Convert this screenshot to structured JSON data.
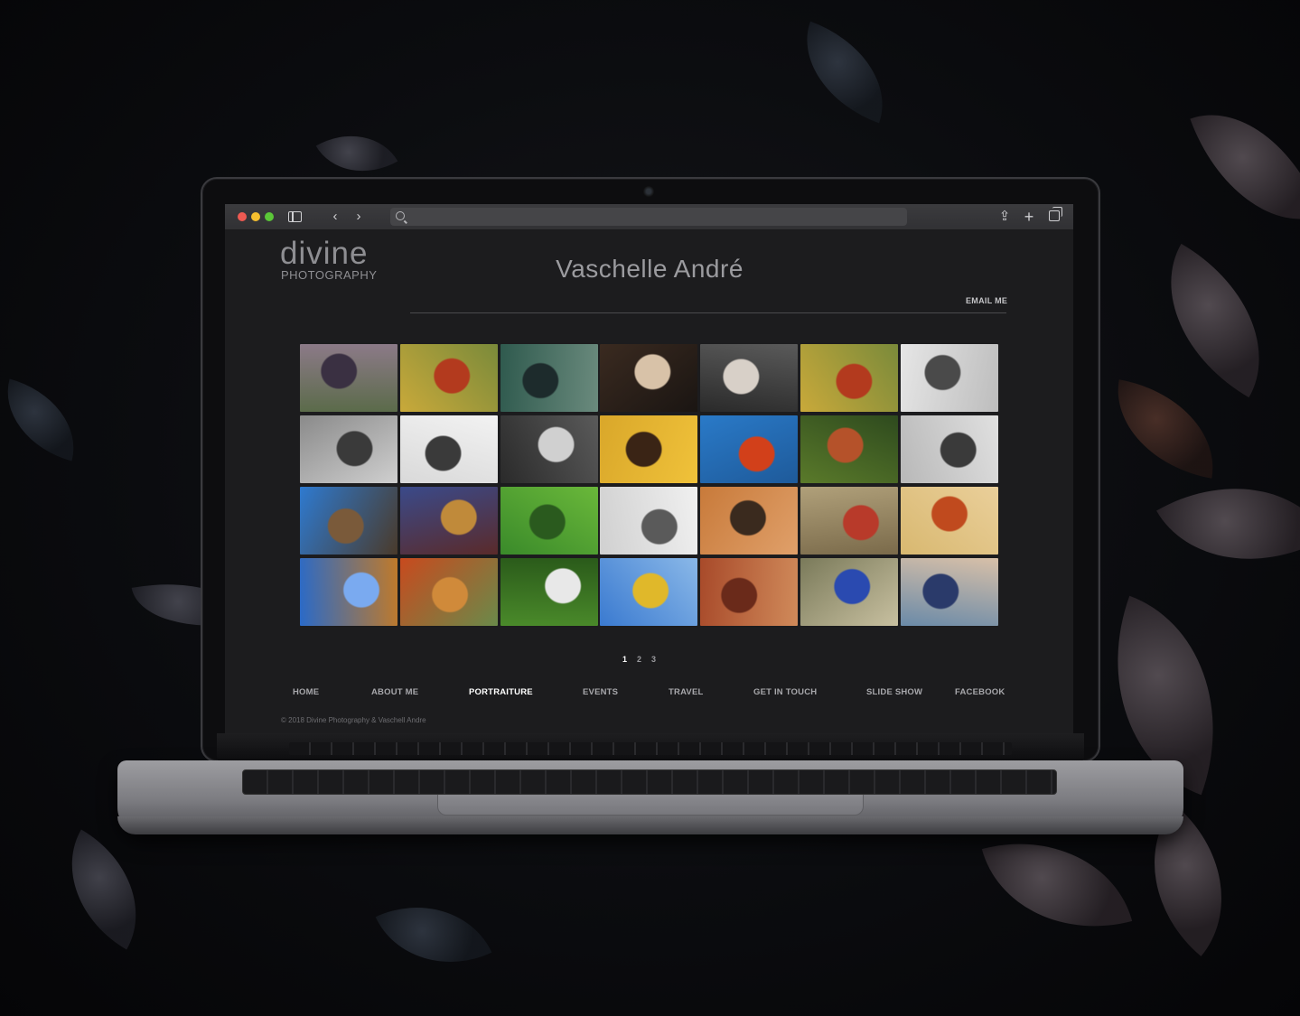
{
  "browser": {
    "address_placeholder": "",
    "icons": [
      "sidebar-icon",
      "back-icon",
      "forward-icon",
      "search-icon",
      "share-icon",
      "plus-icon",
      "tabs-icon"
    ],
    "back_glyph": "‹",
    "forward_glyph": "›",
    "share_glyph": "⇪",
    "plus_glyph": "+"
  },
  "site": {
    "logo_top": "divine",
    "logo_bottom": "PHOTOGRAPHY",
    "title": "Vaschelle André",
    "email_link": "EMAIL ME"
  },
  "gallery": {
    "thumbnails": [
      {
        "colors": [
          "#5b6b4a",
          "#3a3042",
          "#8c7a88"
        ]
      },
      {
        "colors": [
          "#c9a93a",
          "#b33a1e",
          "#7a8a3a"
        ]
      },
      {
        "colors": [
          "#2f5a4e",
          "#1d2b2c",
          "#6a8a7d"
        ]
      },
      {
        "colors": [
          "#3a2a20",
          "#d8c2a8",
          "#1a1512"
        ]
      },
      {
        "colors": [
          "#2a2a2a",
          "#d8d0c8",
          "#5a5a5a"
        ]
      },
      {
        "colors": [
          "#c9a93a",
          "#b33a1e",
          "#7a8a3a"
        ]
      },
      {
        "colors": [
          "#e6e6e6",
          "#4a4a4a",
          "#bdbdbd"
        ]
      },
      {
        "colors": [
          "#8a8a8a",
          "#3a3a3a",
          "#cfcfcf"
        ]
      },
      {
        "colors": [
          "#d9d9d9",
          "#3a3a3a",
          "#f2f2f2"
        ]
      },
      {
        "colors": [
          "#2a2a2a",
          "#d0d0d0",
          "#5a5a5a"
        ]
      },
      {
        "colors": [
          "#d9a72a",
          "#3a2415",
          "#f0c23a"
        ]
      },
      {
        "colors": [
          "#2a7ac8",
          "#d2401a",
          "#1e5a9a"
        ]
      },
      {
        "colors": [
          "#5a7a2a",
          "#b5522a",
          "#2e4a1e"
        ]
      },
      {
        "colors": [
          "#b8b8b8",
          "#3a3a3a",
          "#e0e0e0"
        ]
      },
      {
        "colors": [
          "#2e7ad0",
          "#7a5a3a",
          "#4a3a2a"
        ]
      },
      {
        "colors": [
          "#3a4a8a",
          "#c08a3a",
          "#5a2a2a"
        ]
      },
      {
        "colors": [
          "#3a8a2a",
          "#2a5a1e",
          "#6ab83a"
        ]
      },
      {
        "colors": [
          "#d0d0d0",
          "#5a5a5a",
          "#f0f0f0"
        ]
      },
      {
        "colors": [
          "#c87a3a",
          "#3a2a1e",
          "#e0a06a"
        ]
      },
      {
        "colors": [
          "#b0a07a",
          "#b83a2a",
          "#7a6a4a"
        ]
      },
      {
        "colors": [
          "#d8b870",
          "#c04a1e",
          "#eacf9a"
        ]
      },
      {
        "colors": [
          "#2a6ac8",
          "#7aaaf0",
          "#c07a2a"
        ]
      },
      {
        "colors": [
          "#c84a1e",
          "#d08a3a",
          "#6a8a4a"
        ]
      },
      {
        "colors": [
          "#4a8a2a",
          "#e8e8e8",
          "#2a5a1a"
        ]
      },
      {
        "colors": [
          "#3a7ad0",
          "#e0b82a",
          "#8ab8e8"
        ]
      },
      {
        "colors": [
          "#a84a2a",
          "#6a2a1a",
          "#d08a5a"
        ]
      },
      {
        "colors": [
          "#7a7a5a",
          "#2a4ab0",
          "#c8c0a0"
        ]
      },
      {
        "colors": [
          "#6a8aa8",
          "#2a3a6a",
          "#d8c0a8"
        ]
      }
    ]
  },
  "pagination": {
    "pages": [
      "1",
      "2",
      "3"
    ],
    "current": "1"
  },
  "nav": {
    "items": [
      {
        "label": "HOME"
      },
      {
        "label": "ABOUT ME"
      },
      {
        "label": "PORTRAITURE",
        "active": true
      },
      {
        "label": "EVENTS"
      },
      {
        "label": "TRAVEL"
      },
      {
        "label": "GET IN TOUCH"
      },
      {
        "label": "SLIDE SHOW"
      },
      {
        "label": "FACEBOOK"
      }
    ]
  },
  "footer": {
    "copyright": "© 2018 Divine Photography & Vaschell Andre"
  }
}
